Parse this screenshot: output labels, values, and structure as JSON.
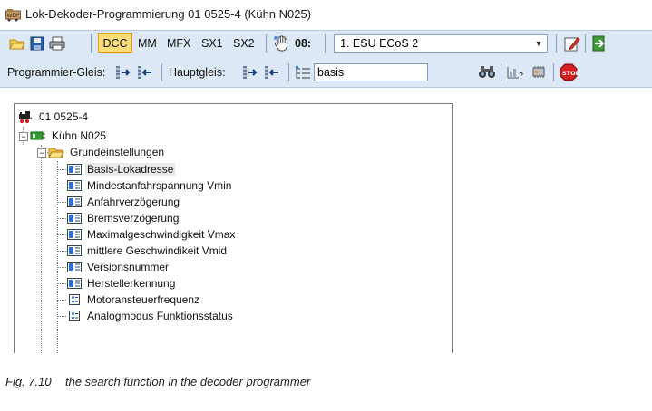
{
  "window": {
    "title": "Lok-Dekoder-Programmierung 01 0525-4 (Kühn N025)"
  },
  "toolbar1": {
    "dcc": "DCC",
    "mm": "MM",
    "mfx": "MFX",
    "sx1": "SX1",
    "sx2": "SX2",
    "port": "08:",
    "station_selected": "1. ESU ECoS 2"
  },
  "toolbar2": {
    "prog_track_label": "Programmier-Gleis:",
    "main_track_label": "Hauptgleis:",
    "search_value": "basis"
  },
  "tree": {
    "root": "01 0525-4",
    "decoder": "Kühn N025",
    "group": "Grundeinstellungen",
    "items": [
      {
        "label": "Basis-Lokadresse",
        "icon": "cv-field-icon"
      },
      {
        "label": "Mindestanfahrspannung Vmin",
        "icon": "cv-field-icon"
      },
      {
        "label": "Anfahrverzögerung",
        "icon": "cv-field-icon"
      },
      {
        "label": "Bremsverzögerung",
        "icon": "cv-field-icon"
      },
      {
        "label": "Maximalgeschwindigkeit Vmax",
        "icon": "cv-field-icon"
      },
      {
        "label": "mittlere Geschwindikeit Vmid",
        "icon": "cv-field-icon"
      },
      {
        "label": "Versionsnummer",
        "icon": "cv-field-icon"
      },
      {
        "label": "Herstellerkennung",
        "icon": "cv-field-icon"
      },
      {
        "label": "Motoransteuerfrequenz",
        "icon": "cv-option-icon"
      },
      {
        "label": "Analogmodus Funktionsstatus",
        "icon": "cv-option-icon"
      }
    ]
  },
  "caption": {
    "number": "Fig. 7.10",
    "text": "the search function in the decoder programmer"
  }
}
